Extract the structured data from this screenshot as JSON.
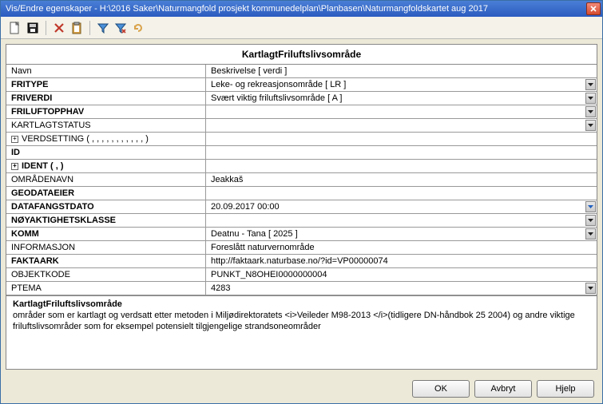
{
  "window": {
    "title": "Vis/Endre egenskaper - H:\\2016 Saker\\Naturmangfold prosjekt kommunedelplan\\Planbasen\\Naturmangfoldskartet aug 2017"
  },
  "heading": "KartlagtFriluftslivsområde",
  "header_row": {
    "left": "Navn",
    "right": "Beskrivelse [ verdi ]"
  },
  "rows": [
    {
      "label": "FRITYPE",
      "value": "Leke- og rekreasjonsområde [ LR ]",
      "bold": true,
      "dd": true
    },
    {
      "label": "FRIVERDI",
      "value": "Svært viktig friluftslivsområde [ A ]",
      "bold": true,
      "dd": true
    },
    {
      "label": "FRILUFTOPPHAV",
      "value": "",
      "bold": true,
      "dd": true
    },
    {
      "label": "KARTLAGTSTATUS",
      "value": "",
      "bold": false,
      "dd": true
    },
    {
      "label": "VERDSETTING ( , , , , , , , , , , , )",
      "value": "",
      "bold": false,
      "expand": true
    },
    {
      "label": "ID",
      "value": "",
      "bold": true
    },
    {
      "label": "IDENT ( , )",
      "value": "",
      "bold": true,
      "expand": true
    },
    {
      "label": "OMRÅDENAVN",
      "value": "Jeakkaš",
      "bold": false
    },
    {
      "label": "GEODATAEIER",
      "value": "",
      "bold": true
    },
    {
      "label": "DATAFANGSTDATO",
      "value": "20.09.2017 00:00",
      "bold": true,
      "dd": true,
      "dd_blue": true
    },
    {
      "label": "NØYAKTIGHETSKLASSE",
      "value": "",
      "bold": true,
      "dd": true
    },
    {
      "label": "KOMM",
      "value": "Deatnu - Tana [ 2025 ]",
      "bold": true,
      "dd": true
    },
    {
      "label": "INFORMASJON",
      "value": "Foreslått naturvernområde",
      "bold": false
    },
    {
      "label": "FAKTAARK",
      "value": "http://faktaark.naturbase.no/?id=VP00000074",
      "bold": true
    },
    {
      "label": "OBJEKTKODE",
      "value": "PUNKT_N8OHEI0000000004",
      "bold": false
    },
    {
      "label": "PTEMA",
      "value": "4283",
      "bold": false,
      "dd": true
    }
  ],
  "description": {
    "title": "KartlagtFriluftslivsområde",
    "text": "områder som er kartlagt og verdsatt etter metoden i Miljødirektoratets <i>Veileder M98-2013 </i>(tidligere DN-håndbok 25 2004) og andre viktige friluftslivsområder som for eksempel potensielt tilgjengelige strandsoneområder"
  },
  "buttons": {
    "ok": "OK",
    "cancel": "Avbryt",
    "help": "Hjelp"
  }
}
